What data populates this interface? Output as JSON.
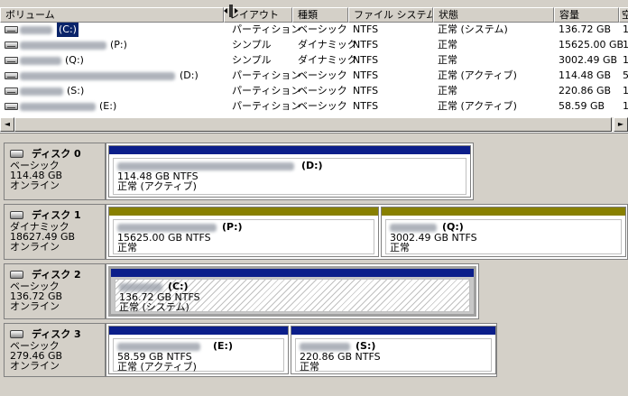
{
  "columns": [
    "ボリューム",
    "レイアウト",
    "種類",
    "ファイル システム",
    "状態",
    "容量",
    "空"
  ],
  "volumes": [
    {
      "letter": "(C:)",
      "layout": "パーティション",
      "type": "ベーシック",
      "fs": "NTFS",
      "status": "正常 (システム)",
      "capacity": "136.72 GB",
      "free": "1"
    },
    {
      "letter": "(P:)",
      "layout": "シンプル",
      "type": "ダイナミック",
      "fs": "NTFS",
      "status": "正常",
      "capacity": "15625.00 GB",
      "free": "1"
    },
    {
      "letter": "(Q:)",
      "layout": "シンプル",
      "type": "ダイナミック",
      "fs": "NTFS",
      "status": "正常",
      "capacity": "3002.49 GB",
      "free": "1"
    },
    {
      "letter": "(D:)",
      "layout": "パーティション",
      "type": "ベーシック",
      "fs": "NTFS",
      "status": "正常 (アクティブ)",
      "capacity": "114.48 GB",
      "free": "5"
    },
    {
      "letter": "(S:)",
      "layout": "パーティション",
      "type": "ベーシック",
      "fs": "NTFS",
      "status": "正常",
      "capacity": "220.86 GB",
      "free": "1"
    },
    {
      "letter": "(E:)",
      "layout": "パーティション",
      "type": "ベーシック",
      "fs": "NTFS",
      "status": "正常 (アクティブ)",
      "capacity": "58.59 GB",
      "free": "1"
    }
  ],
  "scroll": {
    "left_arrow": "◄",
    "right_arrow": "►"
  },
  "disks": [
    {
      "name": "ディスク 0",
      "type": "ベーシック",
      "size": "114.48 GB",
      "state": "オンライン",
      "partitions": [
        {
          "letter": "(D:)",
          "size": "114.48 GB NTFS",
          "status": "正常 (アクティブ)"
        }
      ]
    },
    {
      "name": "ディスク 1",
      "type": "ダイナミック",
      "size": "18627.49 GB",
      "state": "オンライン",
      "partitions": [
        {
          "letter": "(P:)",
          "size": "15625.00 GB NTFS",
          "status": "正常"
        },
        {
          "letter": "(Q:)",
          "size": "3002.49 GB NTFS",
          "status": "正常"
        }
      ]
    },
    {
      "name": "ディスク 2",
      "type": "ベーシック",
      "size": "136.72 GB",
      "state": "オンライン",
      "partitions": [
        {
          "letter": "(C:)",
          "size": "136.72 GB NTFS",
          "status": "正常 (システム)"
        }
      ]
    },
    {
      "name": "ディスク 3",
      "type": "ベーシック",
      "size": "279.46 GB",
      "state": "オンライン",
      "partitions": [
        {
          "letter": "(E:)",
          "size": "58.59 GB NTFS",
          "status": "正常 (アクティブ)"
        },
        {
          "letter": "(S:)",
          "size": "220.86 GB NTFS",
          "status": "正常"
        }
      ]
    }
  ],
  "colors": {
    "basic_bar": "#0b1e8a",
    "dynamic_bar": "#888000",
    "background": "#d4d0c8"
  }
}
